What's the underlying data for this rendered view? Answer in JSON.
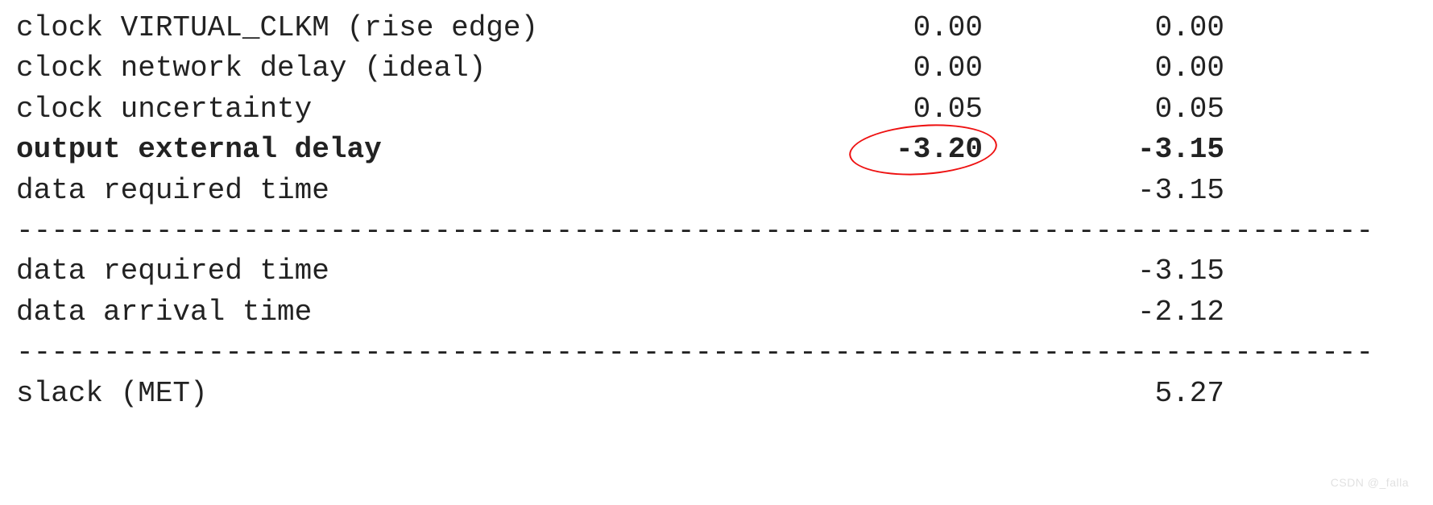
{
  "report": {
    "rows_top": [
      {
        "label": "clock VIRTUAL_CLKM (rise edge)",
        "c1": "0.00",
        "c2": "0.00",
        "bold": false,
        "circled": false
      },
      {
        "label": "clock network delay (ideal)",
        "c1": "0.00",
        "c2": "0.00",
        "bold": false,
        "circled": false
      },
      {
        "label": "clock uncertainty",
        "c1": "0.05",
        "c2": "0.05",
        "bold": false,
        "circled": false
      },
      {
        "label": "output external delay",
        "c1": "-3.20",
        "c2": "-3.15",
        "bold": true,
        "circled": true
      },
      {
        "label": "data required time",
        "c1": "",
        "c2": "-3.15",
        "bold": false,
        "circled": false
      }
    ],
    "rows_mid": [
      {
        "label": "data required time",
        "c1": "",
        "c2": "-3.15",
        "bold": false
      },
      {
        "label": "data arrival time",
        "c1": "",
        "c2": "-2.12",
        "bold": false
      }
    ],
    "rows_bot": [
      {
        "label": "slack (MET)",
        "c1": "",
        "c2": "5.27",
        "bold": false
      }
    ],
    "dashes": "------------------------------------------------------------------------------"
  },
  "watermark": "CSDN @_falla"
}
